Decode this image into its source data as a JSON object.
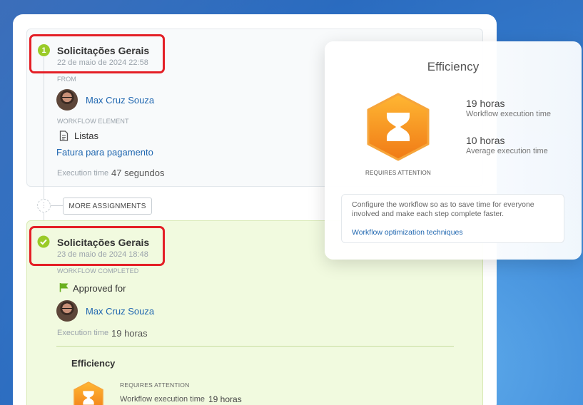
{
  "step1": {
    "badge": "1",
    "title": "Solicitações Gerais",
    "date": "22 de maio de 2024 22:58",
    "from_caption": "FROM",
    "user": "Max Cruz Souza",
    "element_caption": "WORKFLOW ELEMENT",
    "element_type": "Listas",
    "element_link": "Fatura para pagamento",
    "exec_label": "Execution time",
    "exec_value": "47 segundos"
  },
  "more_assignments": "MORE ASSIGNMENTS",
  "step2": {
    "title": "Solicitações Gerais",
    "date": "23 de maio de 2024 18:48",
    "status_caption": "WORKFLOW COMPLETED",
    "approved_label": "Approved for",
    "user": "Max Cruz Souza",
    "exec_label": "Execution time",
    "exec_value": "19 horas",
    "efficiency_title": "Efficiency",
    "requires_attention": "REQUIRES ATTENTION",
    "workflow_exec_label": "Workflow execution time",
    "workflow_exec_value": "19 horas"
  },
  "popup": {
    "title": "Efficiency",
    "status": "REQUIRES ATTENTION",
    "stats": [
      {
        "value": "19 horas",
        "label": "Workflow execution time"
      },
      {
        "value": "10 horas",
        "label": "Average execution time"
      }
    ],
    "tip_text": "Configure the workflow so as to save time for everyone involved and make each step complete faster.",
    "tip_link": "Workflow optimization techniques"
  },
  "colors": {
    "accent_link": "#2067b0",
    "success_green": "#9acb28",
    "highlight_red": "#e41f26",
    "hourglass_orange": "#f7941d"
  },
  "icons": [
    "step-number-icon",
    "checkmark-icon",
    "document-icon",
    "flag-icon",
    "hourglass-icon",
    "more-dots-icon"
  ]
}
